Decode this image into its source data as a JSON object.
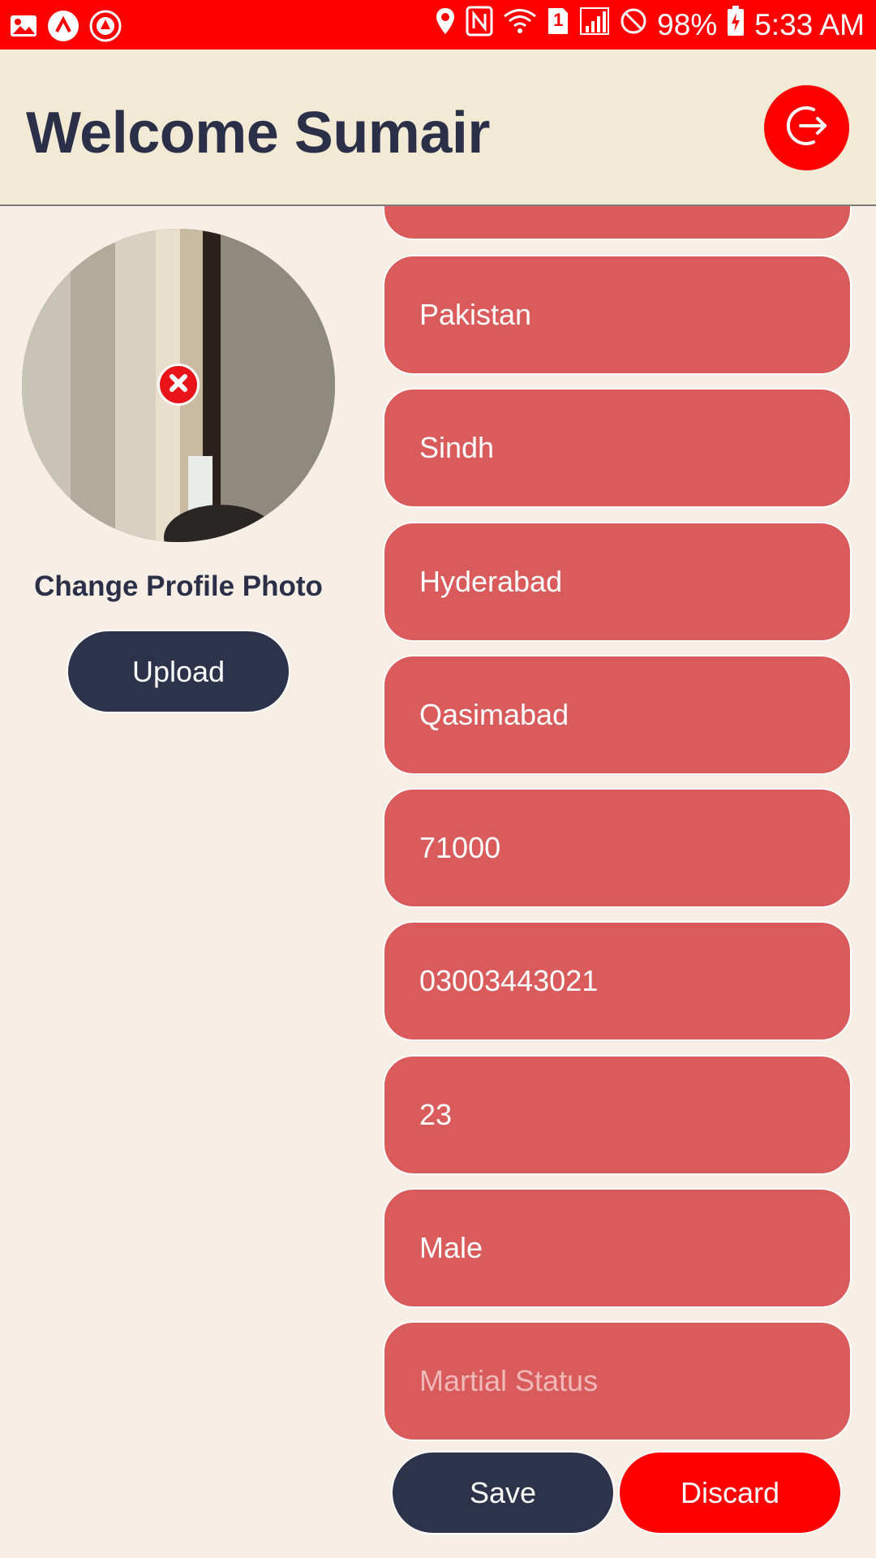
{
  "status_bar": {
    "battery": "98%",
    "time": "5:33 AM",
    "sim_slot": "1",
    "icons": [
      "gallery-icon",
      "app-icon",
      "badge-icon",
      "location-icon",
      "nfc-icon",
      "wifi-icon",
      "sim-icon",
      "signal-icon",
      "no-disturb-icon",
      "battery-charging-icon"
    ]
  },
  "header": {
    "title": "Welcome Sumair",
    "logout_icon": "logout-icon"
  },
  "profile": {
    "change_photo_label": "Change Profile Photo",
    "upload_label": "Upload",
    "remove_icon": "close-icon"
  },
  "form": {
    "fields": [
      {
        "name": "country",
        "value": "Pakistan",
        "placeholder": ""
      },
      {
        "name": "province",
        "value": "Sindh",
        "placeholder": ""
      },
      {
        "name": "city",
        "value": "Hyderabad",
        "placeholder": ""
      },
      {
        "name": "area",
        "value": "Qasimabad",
        "placeholder": ""
      },
      {
        "name": "postal-code",
        "value": "71000",
        "placeholder": ""
      },
      {
        "name": "phone",
        "value": "03003443021",
        "placeholder": ""
      },
      {
        "name": "age",
        "value": "23",
        "placeholder": ""
      },
      {
        "name": "gender",
        "value": "Male",
        "placeholder": ""
      },
      {
        "name": "marital-status",
        "value": "",
        "placeholder": "Martial Status"
      }
    ]
  },
  "actions": {
    "save_label": "Save",
    "discard_label": "Discard"
  },
  "colors": {
    "status_bar": "#ff0000",
    "header_bg": "#f3ead6",
    "page_bg": "#f7eee5",
    "field_bg": "#d95b5b",
    "primary_dark": "#2d334a",
    "accent_red": "#ff0000"
  }
}
